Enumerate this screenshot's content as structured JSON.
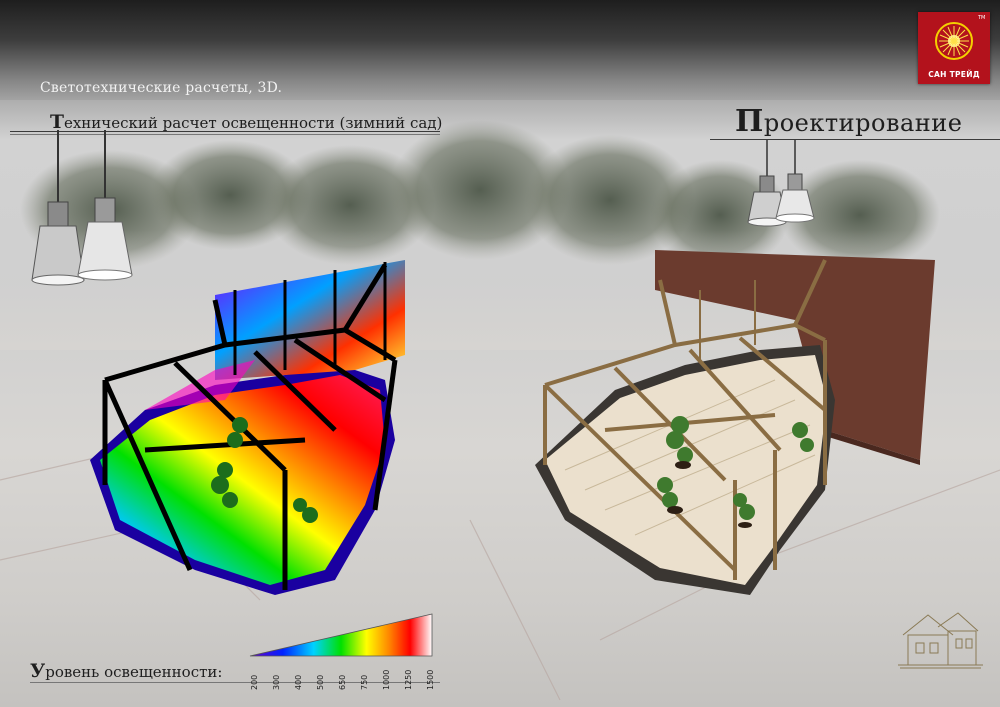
{
  "header": {
    "subtitle": "Светотехнические расчеты, 3D.",
    "headline_initial": "Т",
    "headline_rest": "ехнический расчет освещенности (зимний сад)",
    "design_initial": "П",
    "design_rest": "роектирование"
  },
  "logo": {
    "text": "САН ТРЕЙД",
    "tm": "TM",
    "color": "#b3121c"
  },
  "legend": {
    "label_initial": "У",
    "label_rest": "ровень освещенности:",
    "ticks": [
      "200",
      "300",
      "400",
      "500",
      "650",
      "750",
      "1000",
      "1250",
      "1500"
    ],
    "gradient_colors": [
      "#6a00c8",
      "#0022ff",
      "#00d2ff",
      "#00e000",
      "#ffff00",
      "#ff8000",
      "#ff0000",
      "#ffffff"
    ]
  },
  "icons": {
    "lamps": "pendant-lamp-icon",
    "house": "house-sketch-icon"
  }
}
